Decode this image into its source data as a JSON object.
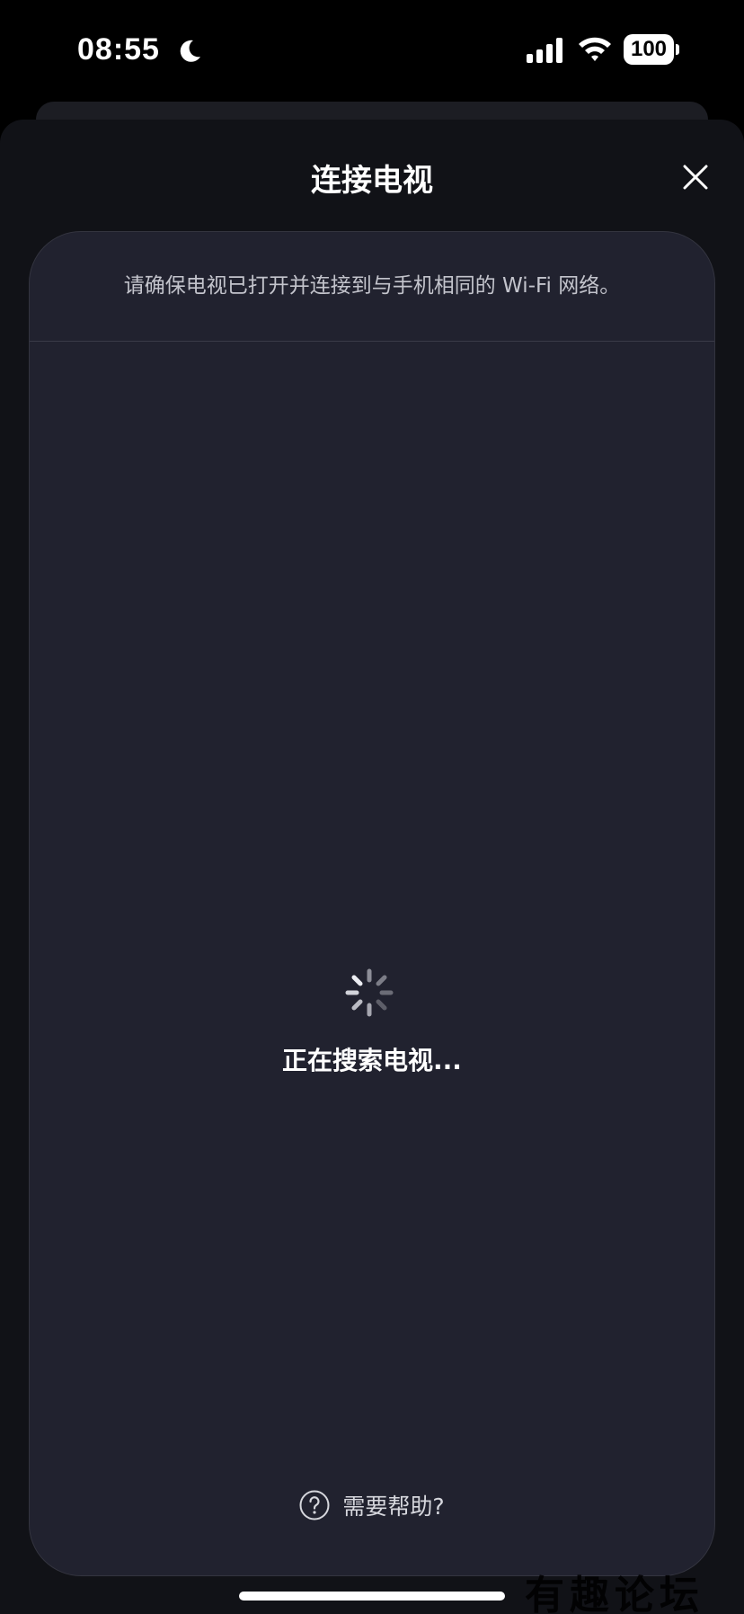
{
  "status_bar": {
    "time": "08:55",
    "battery": "100",
    "icons": [
      "moon-icon",
      "signal-icon",
      "wifi-icon",
      "battery-icon"
    ]
  },
  "sheet": {
    "title": "连接电视",
    "close_icon": "close-icon",
    "hint": "请确保电视已打开并连接到与手机相同的 Wi-Fi 网络。",
    "status_text": "正在搜索电视...",
    "help_label": "需要帮助?"
  },
  "watermark": "有趣论坛",
  "colors": {
    "sheet_bg": "#111217",
    "card_bg": "#21222f",
    "text_primary": "#ffffff",
    "text_secondary": "#c3c4cc"
  }
}
